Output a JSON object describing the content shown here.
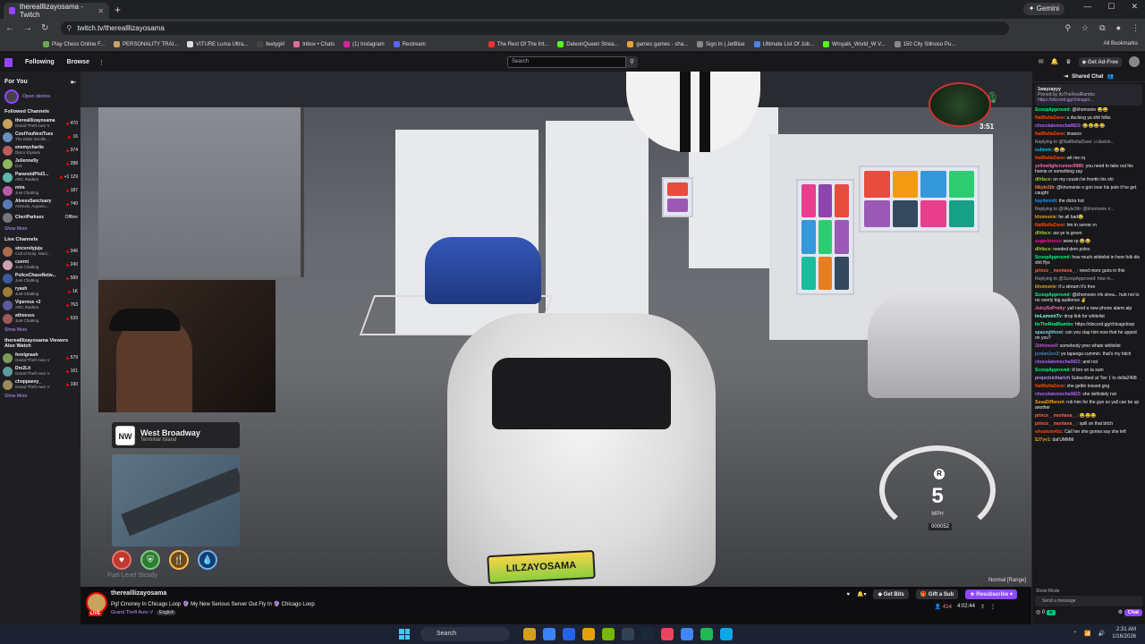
{
  "browser": {
    "tab_title": "therealllizayosama - Twitch",
    "url": "twitch.tv/therealllizayosama",
    "gemini_label": "Gemini",
    "bookmarks": [
      "Play Chess Online F...",
      "PERSONALITY TRAI...",
      "VITURE Luma Ultra...",
      "feetygirl",
      "Inbox • Chats",
      "(1) Instagram",
      "Restream",
      "The Rest Of The Int...",
      "DeleonQueen Strea...",
      "games games - sha...",
      "Sign In | JetBlue",
      "Ultimate List Of Job...",
      "Wroyals_World_W V...",
      "150 City Sillnoso Pu..."
    ],
    "all_bookmarks": "All Bookmarks"
  },
  "twitch_nav": {
    "following": "Following",
    "browse": "Browse",
    "search_placeholder": "Search",
    "get_ad_free": "Get Ad-Free"
  },
  "sidebar": {
    "for_you": "For You",
    "open_stories": "Open stories",
    "followed_title": "Followed Channels",
    "followed": [
      {
        "name": "therealllizayosama",
        "game": "Grand Theft Auto V",
        "viewers": "470",
        "color": "#c9a25e"
      },
      {
        "name": "CoolYouNextTues",
        "game": "The Elder Scrolls...",
        "viewers": "16",
        "color": "#6a8fbf"
      },
      {
        "name": "enemycharlie",
        "game": "Disco Elysium",
        "viewers": "374",
        "color": "#b85c5c"
      },
      {
        "name": "Julienne9y",
        "game": "DJs",
        "viewers": "288",
        "color": "#8fb85c"
      },
      {
        "name": "ParanoidPlsI3...",
        "game": "ARC Raiders",
        "viewers": "+1 129",
        "color": "#5cb8a8"
      },
      {
        "name": "mira",
        "game": "Just Chatting",
        "viewers": "187",
        "color": "#b85ca8"
      },
      {
        "name": "AlvessSanctuary",
        "game": "Animals, Aquariu...",
        "viewers": "740",
        "color": "#5c7ab8"
      },
      {
        "name": "CheriParksex",
        "game": "",
        "viewers": "Offline",
        "color": "#777"
      }
    ],
    "show_more_1": "Show More",
    "live_title": "Live Channels",
    "live": [
      {
        "name": "sincerelyjuju",
        "game": "Call of Duty: Warz...",
        "viewers": "346",
        "color": "#a86c4c"
      },
      {
        "name": "cuerni",
        "game": "Just Chatting",
        "viewers": "240",
        "color": "#d0a0b0"
      },
      {
        "name": "PoliceChaseNetw...",
        "game": "Just Chatting",
        "viewers": "589",
        "color": "#3c5a9c"
      },
      {
        "name": "ryash",
        "game": "Just Chatting",
        "viewers": "1K",
        "color": "#9c7c3c"
      },
      {
        "name": "Viperous +2",
        "game": "ARC Raiders",
        "viewers": "763",
        "color": "#5c5c9c"
      },
      {
        "name": "athoesss",
        "game": "Just Chatting",
        "viewers": "539",
        "color": "#9c5c5c"
      }
    ],
    "show_more_2": "Show More",
    "also_watch_title": "therealllizayosama Viewers Also Watch",
    "also_watch": [
      {
        "name": "foreignash",
        "game": "Grand Theft Auto V",
        "viewers": "579",
        "color": "#7c9c5c"
      },
      {
        "name": "Dre2Lit",
        "game": "Grand Theft Auto V",
        "viewers": "161",
        "color": "#5c9c9c"
      },
      {
        "name": "choppaeny_",
        "game": "Grand Theft Auto V",
        "viewers": "190",
        "color": "#9c8c5c"
      }
    ],
    "show_more_3": "Show More"
  },
  "video": {
    "location_code": "NW",
    "street": "West Broadway",
    "zone": "Terminal Island",
    "speed": "5",
    "speed_unit": "MPH",
    "gear": "R",
    "odometer": "000052",
    "clock": "3:51",
    "watermark": "LILZAYOSAMA",
    "hud_note": "Fuel Level Steady",
    "status": "Normal [Range]"
  },
  "stream_info": {
    "streamer": "therealllizayosama",
    "live_label": "LIVE",
    "title": "Pgf Cmoney In Chicago Loop 🔮 My New Serious Server Out Fly In 🔮 Chicago Loop",
    "game": "Grand Theft Auto V",
    "language": "English",
    "get_bits": "Get Bits",
    "gift_sub": "Gift a Sub",
    "resubscribe": "Resubscribe",
    "viewers": "414",
    "uptime": "4:02:44"
  },
  "chat": {
    "header": "Shared Chat",
    "pinned_user": "1wayzayyy",
    "pinned_by": "Pinned by ItsTheRealRambo",
    "pinned_link": "https://discord.gg/chicagol...",
    "messages": [
      {
        "user": "ScoopApproved",
        "color": "#00ff7f",
        "text": ": @khomonie 😂😂"
      },
      {
        "user": "NatMafiaDave",
        "color": "#ff4500",
        "text": ": u ducking ya shit folks"
      },
      {
        "user": "chocolatemocha0823",
        "color": "#b065ff",
        "text": ": 😂😂😂😂"
      },
      {
        "user": "NatMafiaDave",
        "color": "#ff4500",
        "text": ": lmaooo"
      },
      {
        "user": "",
        "color": "#adadb8",
        "text": "Replying to @NatMafiaDave: u duckin..."
      },
      {
        "user": "culmvic",
        "color": "#00c8ff",
        "text": ": 😂😂"
      },
      {
        "user": "NatMafiaDave",
        "color": "#ff4500",
        "text": ": wit me rq"
      },
      {
        "user": "yellowlighcrunner9985",
        "color": "#ff69b4",
        "text": ": you need to take out his homie or something zay"
      },
      {
        "user": "dlhface",
        "color": "#9acd32",
        "text": ": on my cousin he frontin his shi"
      },
      {
        "user": "lilkyle2tb",
        "color": "#ff7f50",
        "text": ": @khomonie n gon lose his pole if he get caught"
      },
      {
        "user": "kaydenrdt",
        "color": "#1e90ff",
        "text": ": the dicks hot"
      },
      {
        "user": "",
        "color": "#adadb8",
        "text": "Replying to @lilkyle2tb: @khomonie n..."
      },
      {
        "user": "khomonie",
        "color": "#daa520",
        "text": ": he all bad😂"
      },
      {
        "user": "NatMafiaDave",
        "color": "#ff4500",
        "text": ": hm in server rn"
      },
      {
        "user": "dlhface",
        "color": "#9acd32",
        "text": ": aw ye is green"
      },
      {
        "user": "sugarbrezzz",
        "color": "#ff1493",
        "text": ": www rp 😂😂"
      },
      {
        "user": "dlhface",
        "color": "#9acd32",
        "text": ": needed dem poles"
      },
      {
        "user": "ScoopApproved",
        "color": "#00ff7f",
        "text": ": how much whitelist in here folk dis shit flys"
      },
      {
        "user": "prince__montana__",
        "color": "#ff6347",
        "text": ": need more guns in this"
      },
      {
        "user": "",
        "color": "#adadb8",
        "text": "Replying to @ScoopApproved: how m..."
      },
      {
        "user": "khomonie",
        "color": "#daa520",
        "text": ": if u stream It's free"
      },
      {
        "user": "ScoopApproved",
        "color": "#00ff7f",
        "text": ": @khomonie nfs strea... hub not to no overly big audience ✌"
      },
      {
        "user": "JuicySoPretty",
        "color": "#ff69b4",
        "text": ": yall need a new phone alarm alp"
      },
      {
        "user": "ImLamontTv",
        "color": "#7fffd4",
        "text": ": drop link for whitelist"
      },
      {
        "user": "ItsTheRealRambo",
        "color": "#00ff7f",
        "text": ": https://discord.gg/chicagoloop"
      },
      {
        "user": "spaceghhost",
        "color": "#87ceeb",
        "text": ": can you clap him now that he upped on you?"
      },
      {
        "user": "2bthimself",
        "color": "#ba55d3",
        "text": ": somebody pmo whats whitelist"
      },
      {
        "user": "jordan2xx3",
        "color": "#4682b4",
        "text": ": yo tapanga cummin. that's my bitch"
      },
      {
        "user": "chocolatemocha0823",
        "color": "#b065ff",
        "text": ": and not"
      },
      {
        "user": "ScoopApproved",
        "color": "#00ff7f",
        "text": ": ill bro on ta sum"
      },
      {
        "user": "projectrichiarich",
        "color": "#bf94ff",
        "text": " Subscribed at Tier 1 to dolla2408"
      },
      {
        "user": "NatMafiaDave",
        "color": "#ff4500",
        "text": ": she gettin tossed gng"
      },
      {
        "user": "chocolatemocha0823",
        "color": "#b065ff",
        "text": ": she definitely not"
      },
      {
        "user": "SosaDifferent",
        "color": "#ffa500",
        "text": ": rob him for the gun so yall can be up another"
      },
      {
        "user": "prince__montana__",
        "color": "#ff6347",
        "text": ": 😂😂😂"
      },
      {
        "user": "prince__montana__",
        "color": "#ff6347",
        "text": ": spill on that bitch"
      },
      {
        "user": "whoatom41c",
        "color": "#ff4500",
        "text": ": Call her she gonna say she left"
      },
      {
        "user": "$J7yv1",
        "color": "#daa520",
        "text": ": dat'UMMM"
      }
    ],
    "show_mode": "Show Mode",
    "input_placeholder": "Send a message",
    "points": "0",
    "chat_button": "Chat"
  },
  "taskbar": {
    "search": "Search",
    "time": "2:31 AM",
    "date": "1/16/2026"
  },
  "colors": {
    "twitch_purple": "#9146ff",
    "live_red": "#eb0400"
  }
}
